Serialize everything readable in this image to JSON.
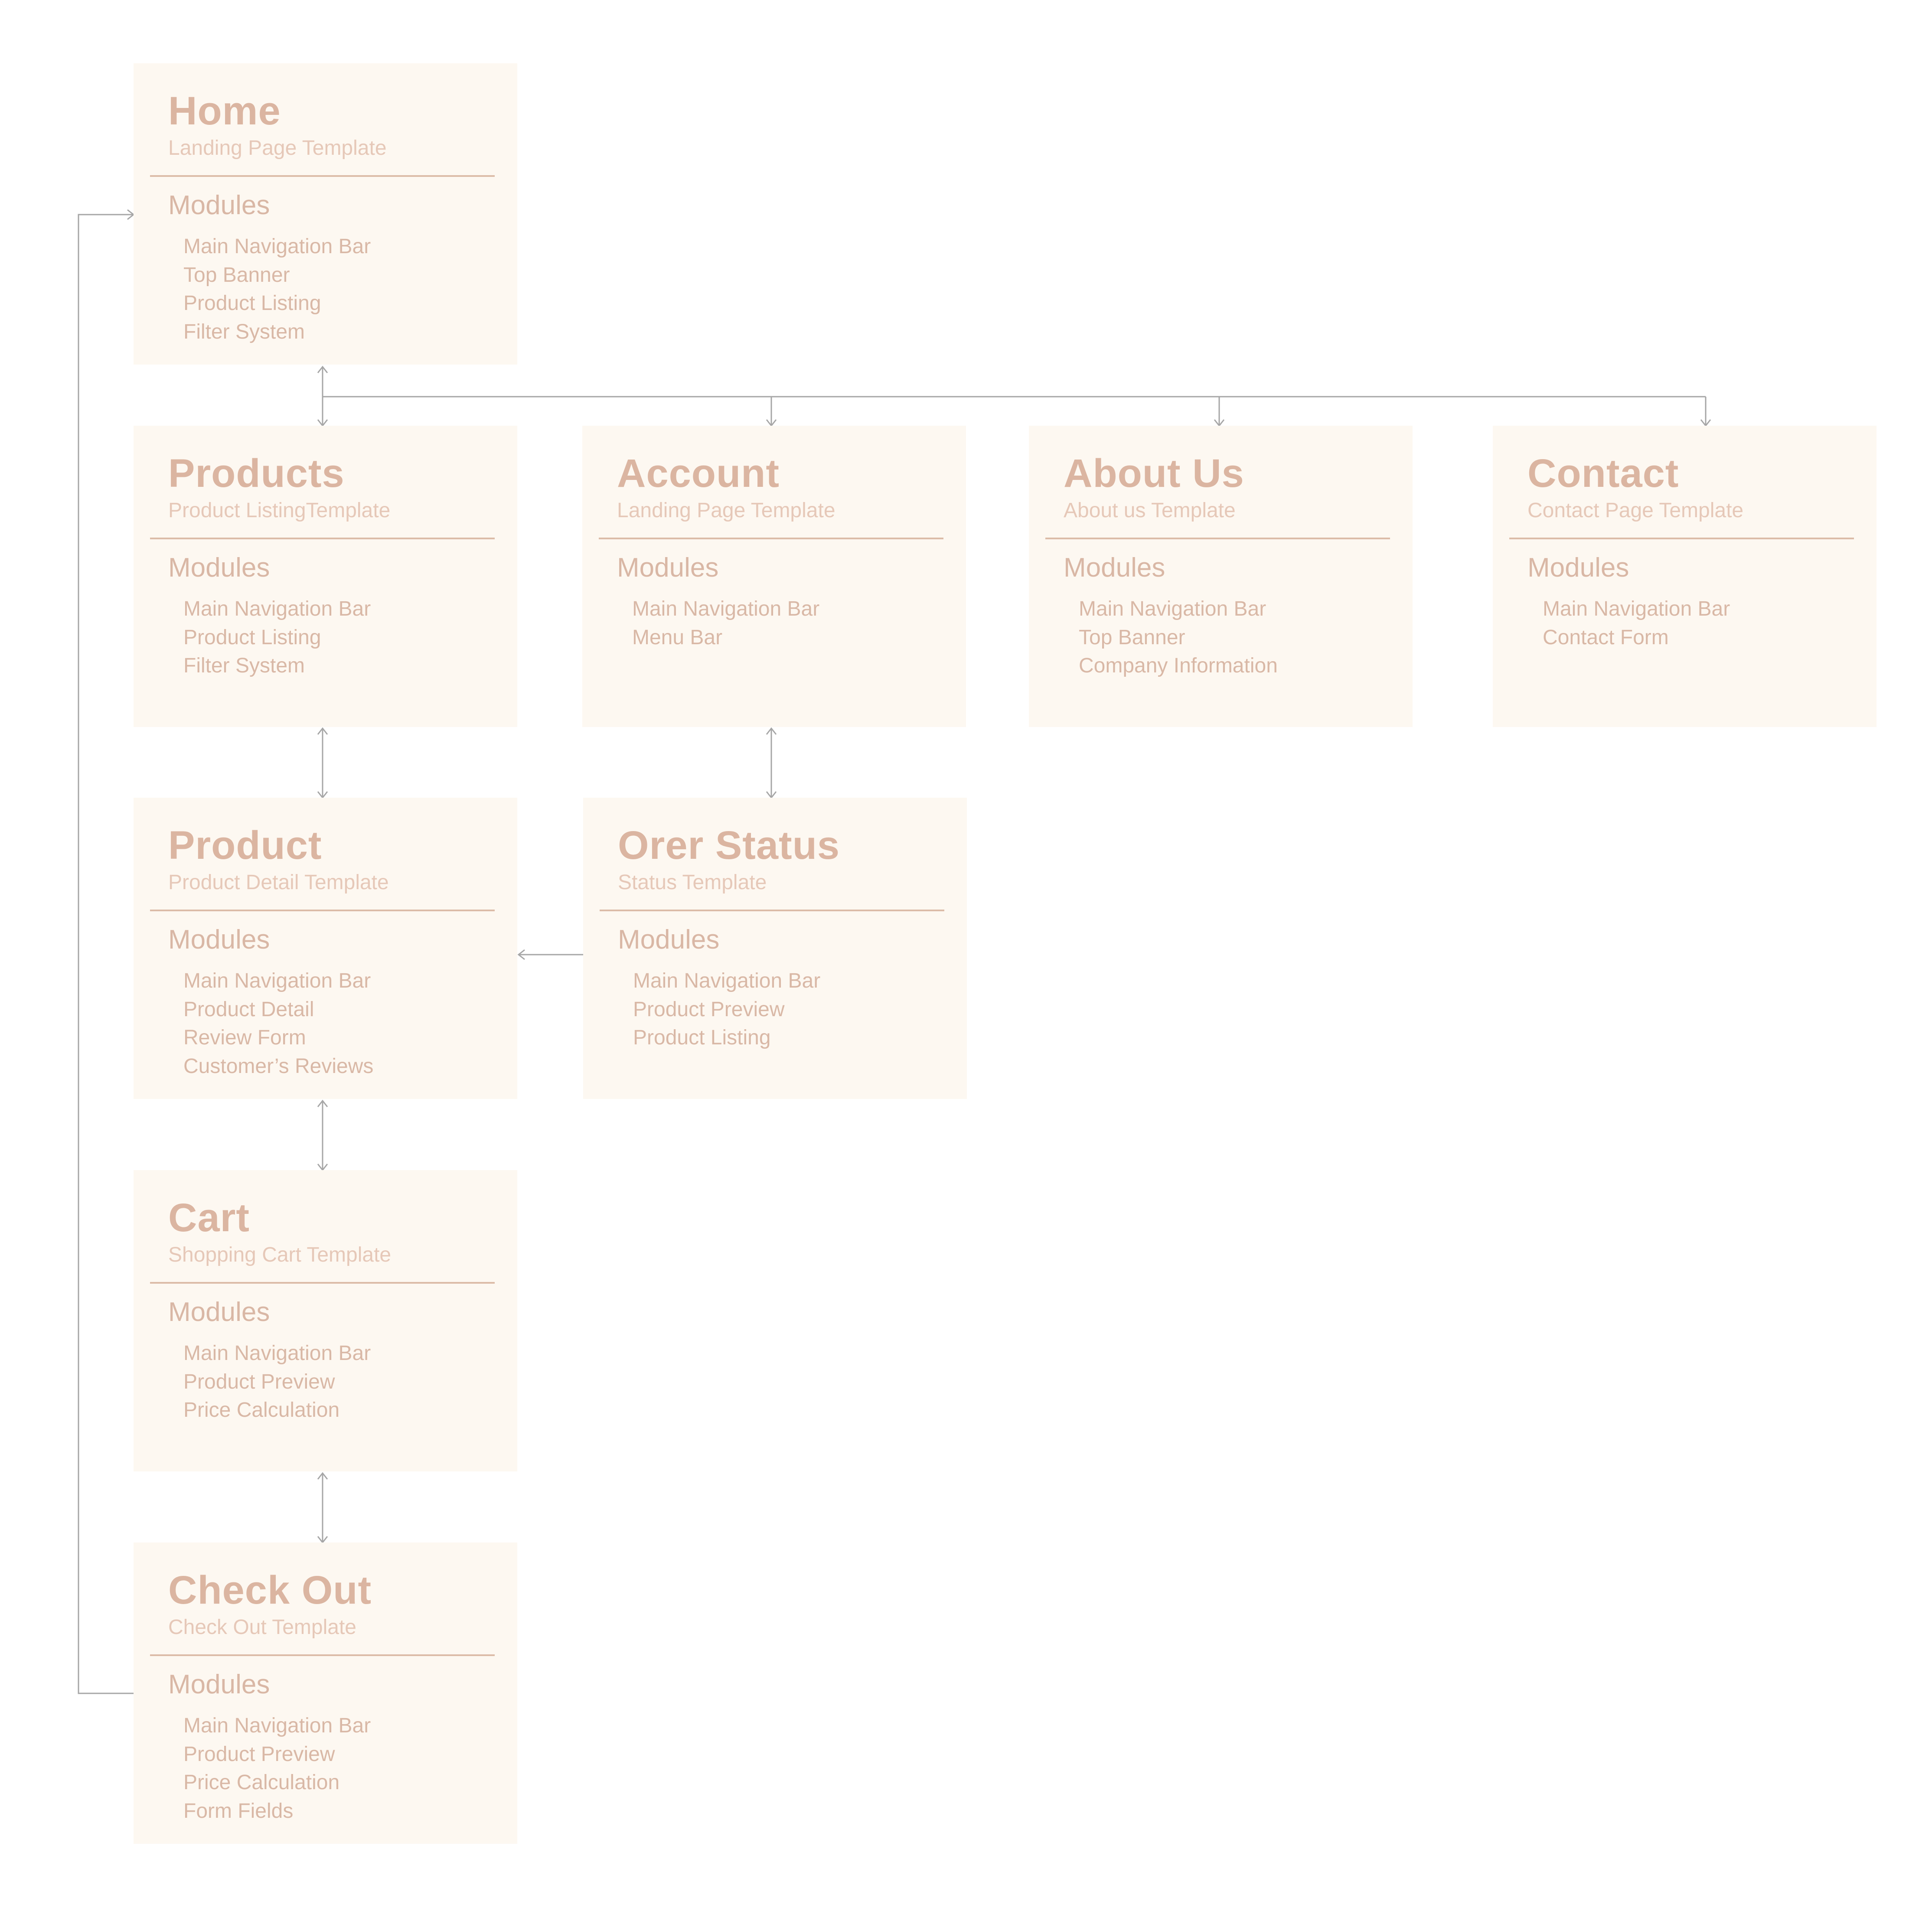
{
  "colors": {
    "background": "#ffffff",
    "card_background": "#fdf8f1",
    "title": "#dbb5a1",
    "subtitle": "#e6c8b8",
    "divider": "#dcbca8",
    "modules_text": "#d9b8a6",
    "connector": "#a6a6a6"
  },
  "cards": {
    "home": {
      "title": "Home",
      "subtitle": "Landing Page Template",
      "modules_label": "Modules",
      "modules": [
        "Main Navigation Bar",
        "Top Banner",
        "Product Listing",
        "Filter System"
      ]
    },
    "products": {
      "title": "Products",
      "subtitle": "Product ListingTemplate",
      "modules_label": "Modules",
      "modules": [
        "Main Navigation Bar",
        "Product Listing",
        "Filter System"
      ]
    },
    "account": {
      "title": "Account",
      "subtitle": "Landing Page Template",
      "modules_label": "Modules",
      "modules": [
        "Main Navigation Bar",
        "Menu Bar"
      ]
    },
    "about": {
      "title": "About Us",
      "subtitle": "About us Template",
      "modules_label": "Modules",
      "modules": [
        "Main Navigation Bar",
        "Top Banner",
        "Company Information"
      ]
    },
    "contact": {
      "title": "Contact",
      "subtitle": "Contact Page Template",
      "modules_label": "Modules",
      "modules": [
        "Main Navigation Bar",
        "Contact Form"
      ]
    },
    "product": {
      "title": "Product",
      "subtitle": "Product Detail Template",
      "modules_label": "Modules",
      "modules": [
        "Main Navigation Bar",
        "Product Detail",
        "Review Form",
        "Customer’s Reviews"
      ]
    },
    "order_status": {
      "title": "Orer Status",
      "subtitle": "Status Template",
      "modules_label": "Modules",
      "modules": [
        "Main Navigation Bar",
        "Product Preview",
        "Product Listing"
      ]
    },
    "cart": {
      "title": "Cart",
      "subtitle": "Shopping Cart Template",
      "modules_label": "Modules",
      "modules": [
        "Main Navigation Bar",
        "Product Preview",
        "Price Calculation"
      ]
    },
    "checkout": {
      "title": "Check Out",
      "subtitle": "Check Out Template",
      "modules_label": "Modules",
      "modules": [
        "Main Navigation Bar",
        "Product Preview",
        "Price Calculation",
        "Form Fields"
      ]
    }
  }
}
